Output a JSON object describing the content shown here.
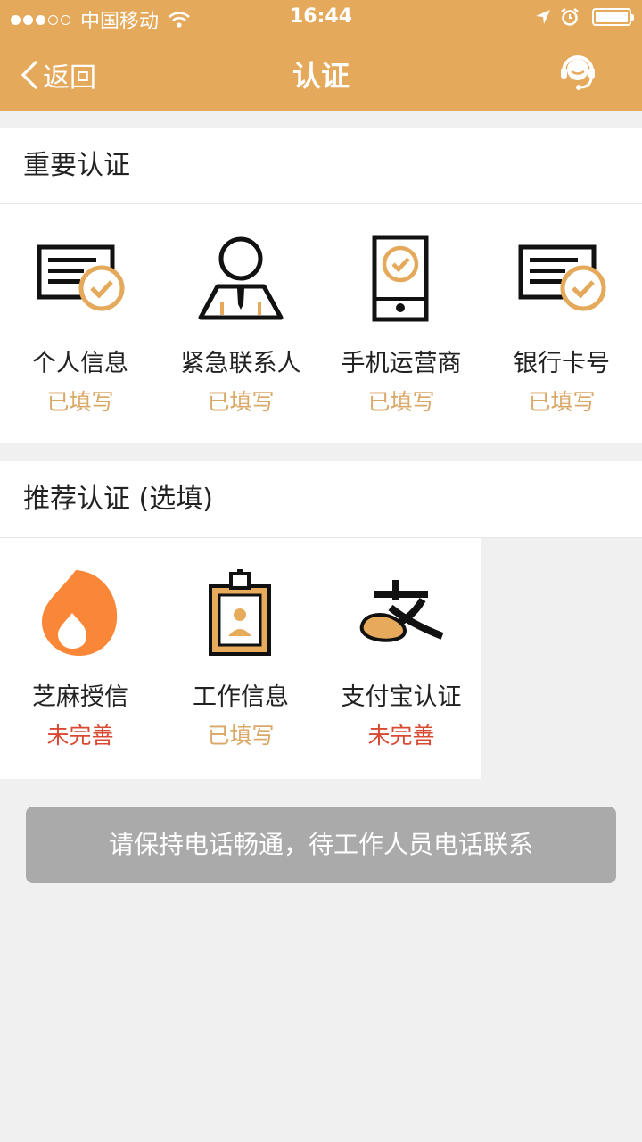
{
  "status_bar": {
    "carrier": "中国移动",
    "time": "16:44"
  },
  "nav": {
    "back_label": "返回",
    "title": "认证",
    "support_icon": "customer-service-icon"
  },
  "colors": {
    "brand": "#e4a95b",
    "filled": "#d9a766",
    "incomplete": "#d84a32",
    "notice_bg": "#aaaaaa"
  },
  "important": {
    "heading": "重要认证",
    "items": [
      {
        "label": "个人信息",
        "status": "已填写",
        "icon": "id-card-check-icon"
      },
      {
        "label": "紧急联系人",
        "status": "已填写",
        "icon": "contact-person-icon"
      },
      {
        "label": "手机运营商",
        "status": "已填写",
        "icon": "phone-check-icon"
      },
      {
        "label": "银行卡号",
        "status": "已填写",
        "icon": "bank-card-check-icon"
      }
    ]
  },
  "recommended": {
    "heading": "推荐认证 (选填)",
    "items": [
      {
        "label": "芝麻授信",
        "status": "未完善",
        "icon": "sesame-credit-icon"
      },
      {
        "label": "工作信息",
        "status": "已填写",
        "icon": "work-badge-icon"
      },
      {
        "label": "支付宝认证",
        "status": "未完善",
        "icon": "alipay-icon"
      }
    ]
  },
  "notice": "请保持电话畅通，待工作人员电话联系"
}
